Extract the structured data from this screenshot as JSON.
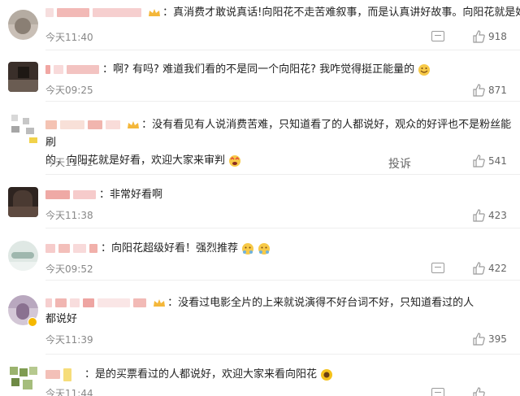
{
  "comments": [
    {
      "text": "真消费才敢说真话!向阳花不走苦难叙事，而是认真讲好故事。向阳花就是好看",
      "time": "今天11:40",
      "likes": "918",
      "report": ""
    },
    {
      "text": "啊? 有吗? 难道我们看的不是同一个向阳花? 我咋觉得挺正能量的",
      "time": "今天09:25",
      "likes": "871",
      "report": ""
    },
    {
      "text_line1": "没有看见有人说消费苦难，只知道看了的人都说好，观众的好评也不是粉丝能刷",
      "text_line2": "的，向阳花就是好看，欢迎大家来审判",
      "time": "今天11:42",
      "likes": "541",
      "report": "投诉"
    },
    {
      "text": "非常好看啊",
      "time": "今天11:38",
      "likes": "423",
      "report": ""
    },
    {
      "text": "向阳花超级好看！强烈推荐",
      "time": "今天09:52",
      "likes": "422",
      "report": ""
    },
    {
      "text_line1": "没看过电影全片的上来就说演得不好台词不好，只知道看过的人",
      "text_line2": "都说好",
      "time": "今天11:39",
      "likes": "395",
      "report": ""
    },
    {
      "text": "是的买票看过的人都说好，欢迎大家来看向阳花",
      "time": "今天11:44",
      "likes": "",
      "report": ""
    }
  ],
  "colors": {
    "mosaic_pink": "#f4c7c3",
    "mosaic_peach": "#f7d6bf",
    "text": "#222222",
    "meta": "#888888"
  },
  "icons": {
    "reply": "comment-bubble-icon",
    "like": "thumbs-up-icon",
    "vip": "crown-vip-icon"
  }
}
